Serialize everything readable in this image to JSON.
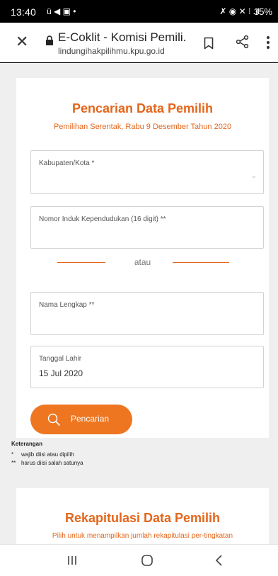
{
  "status_bar": {
    "time": "13:40",
    "left_icons": "ü ◀ ▣ •",
    "right_icons": "✗ ◉ ✕ ⁞ .ıl",
    "battery": "35%"
  },
  "browser": {
    "title": "E-Coklit - Komisi Pemili...",
    "url": "lindungihakpilihmu.kpu.go.id",
    "icons": [
      "close-icon",
      "lock-icon",
      "bookmark-icon",
      "share-icon",
      "more-icon"
    ]
  },
  "search_card": {
    "heading": "Pencarian Data Pemilih",
    "subheading": "Pemilihan Serentak, Rabu 9 Desember Tahun 2020",
    "fields": {
      "kabupaten": {
        "label": "Kabupaten/Kota *",
        "value": ""
      },
      "nik": {
        "label": "Nomor Induk Kependudukan (16 digit) **",
        "value": ""
      },
      "nama": {
        "label": "Nama Lengkap **",
        "value": ""
      },
      "tanggal": {
        "label": "Tanggal Lahir",
        "value": "15 Jul 2020"
      }
    },
    "divider_text": "atau",
    "search_button": "Pencarian"
  },
  "notes": {
    "title": "Keterangan",
    "items": [
      {
        "mark": "*",
        "text": "wajib diisi atau dipilih"
      },
      {
        "mark": "**",
        "text": "harus diisi salah satunya"
      }
    ]
  },
  "recap_card": {
    "heading": "Rekapitulasi Data Pemilih",
    "subheading": "Pilih untuk menampilkan jumlah rekapitulasi per-tingkatan"
  },
  "colors": {
    "accent": "#e4661c",
    "button": "#ef7621",
    "page_background": "#efefef"
  },
  "nav_icons": [
    "recents-icon",
    "home-icon",
    "back-icon"
  ]
}
